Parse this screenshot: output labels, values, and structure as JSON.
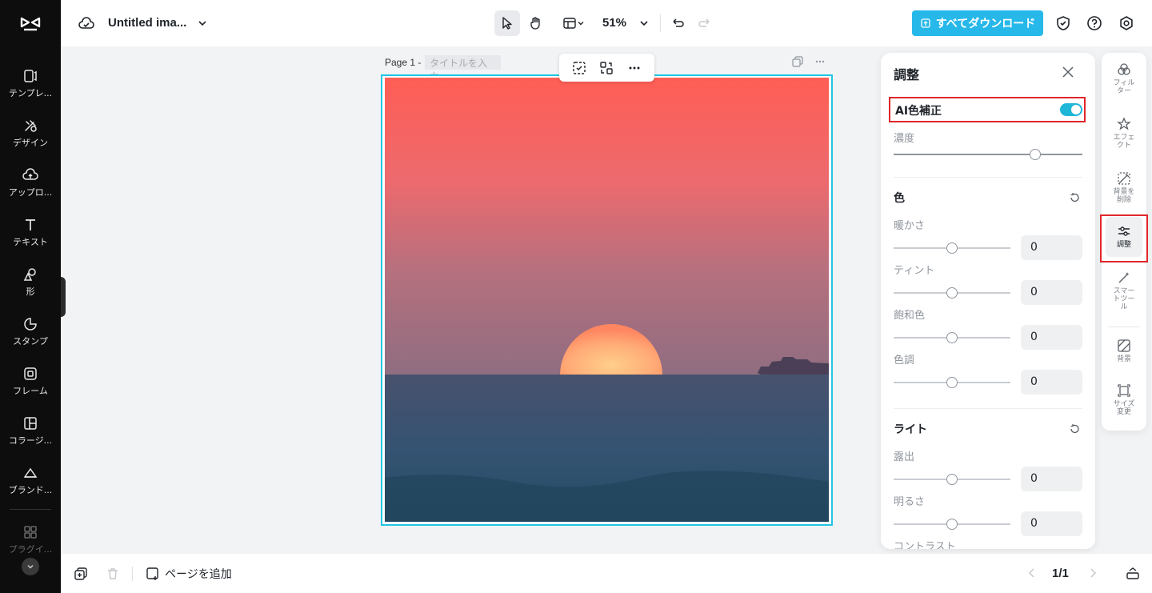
{
  "sidebar": {
    "items": [
      {
        "label": "テンプレ...",
        "icon": "template-icon"
      },
      {
        "label": "デザイン",
        "icon": "design-icon"
      },
      {
        "label": "アップロ...",
        "icon": "upload-icon"
      },
      {
        "label": "テキスト",
        "icon": "text-icon"
      },
      {
        "label": "形",
        "icon": "shape-icon"
      },
      {
        "label": "スタンプ",
        "icon": "sticker-icon"
      },
      {
        "label": "フレーム",
        "icon": "frame-icon"
      },
      {
        "label": "コラージ...",
        "icon": "collage-icon"
      },
      {
        "label": "ブランド...",
        "icon": "brand-icon"
      },
      {
        "label": "プラグイ...",
        "icon": "plugin-icon"
      }
    ]
  },
  "header": {
    "title": "Untitled ima...",
    "zoom": "51%",
    "download_label": "すべてダウンロード"
  },
  "canvas": {
    "page_label": "Page 1 -",
    "title_placeholder": "タイトルを入力"
  },
  "panel": {
    "title": "調整",
    "ai_label": "AI色補正",
    "ai_enabled": true,
    "intensity_label": "濃度",
    "intensity_fraction": 0.75,
    "color_section": "色",
    "color_rows": [
      {
        "label": "暖かさ",
        "value": "0"
      },
      {
        "label": "ティント",
        "value": "0"
      },
      {
        "label": "飽和色",
        "value": "0"
      },
      {
        "label": "色調",
        "value": "0"
      }
    ],
    "light_section": "ライト",
    "light_rows": [
      {
        "label": "露出",
        "value": "0"
      },
      {
        "label": "明るさ",
        "value": "0"
      }
    ],
    "cut_label": "コントラスト"
  },
  "right_tools": {
    "items": [
      {
        "label": "フィル\nター",
        "icon": "filter-icon"
      },
      {
        "label": "エフェ\nクト",
        "icon": "effect-icon"
      },
      {
        "label": "背景を\n削除",
        "icon": "remove-bg-icon"
      },
      {
        "label": "調整",
        "icon": "adjust-icon"
      },
      {
        "label": "スマー\nトツー\nル",
        "icon": "smart-tool-icon"
      },
      {
        "label": "背景",
        "icon": "background-icon"
      },
      {
        "label": "サイズ\n変更",
        "icon": "resize-icon"
      }
    ]
  },
  "footer": {
    "add_page": "ページを追加",
    "pager": "1/1"
  },
  "colors": {
    "accent": "#27b8ea",
    "highlight": "#e0262b",
    "frame": "#22c5e3"
  }
}
